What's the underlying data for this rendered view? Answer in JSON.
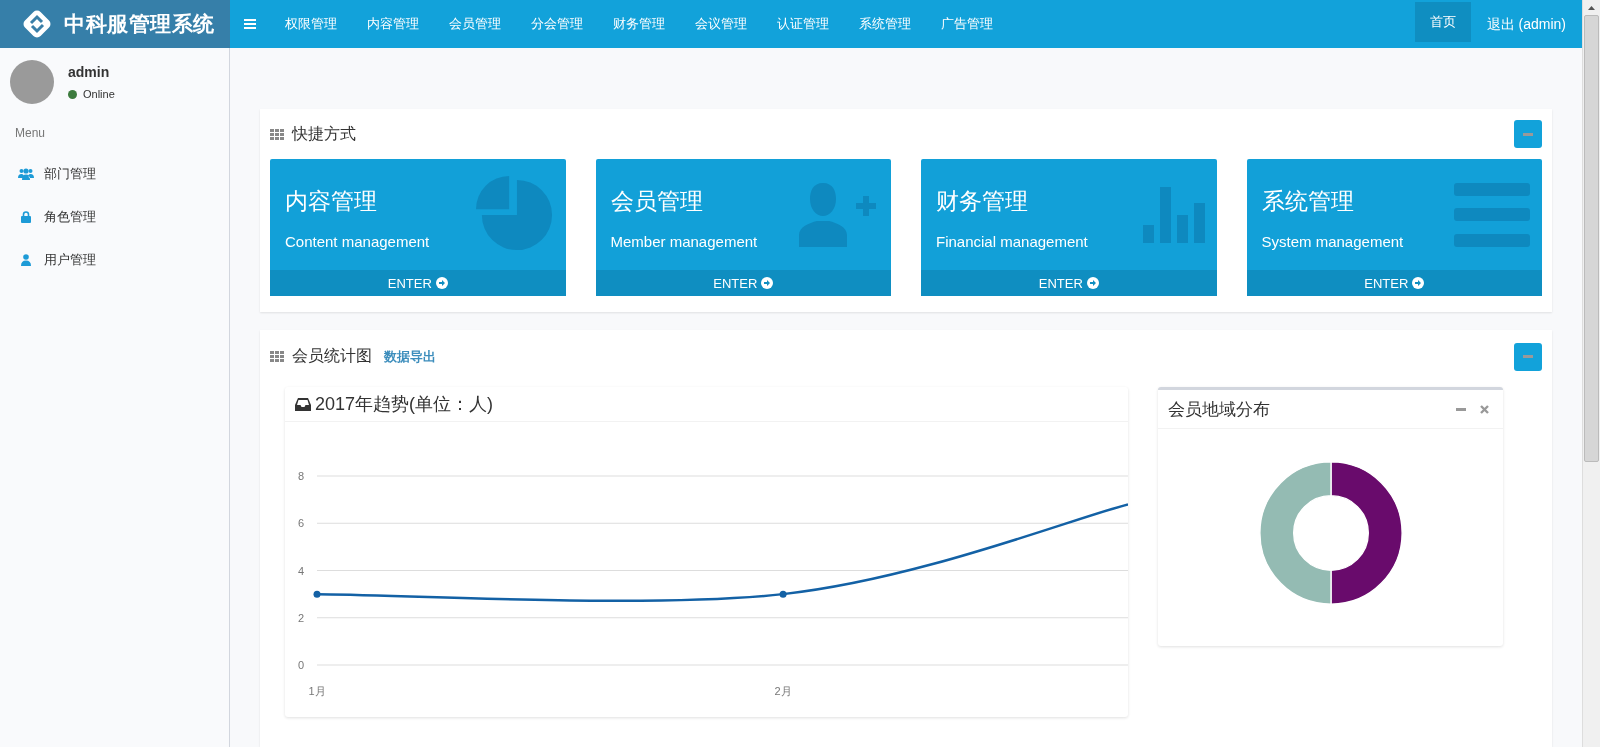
{
  "brand": {
    "title": "中科服管理系统"
  },
  "nav": {
    "items": [
      "权限管理",
      "内容管理",
      "会员管理",
      "分会管理",
      "财务管理",
      "会议管理",
      "认证管理",
      "系统管理",
      "广告管理"
    ],
    "right": [
      {
        "label": "首页",
        "selected": true
      },
      {
        "label": "退出 (admin)",
        "selected": false
      }
    ]
  },
  "user": {
    "name": "admin",
    "status": "Online"
  },
  "sidebar": {
    "heading": "Menu",
    "items": [
      {
        "label": "部门管理",
        "kind": "group"
      },
      {
        "label": "角色管理",
        "kind": "lock"
      },
      {
        "label": "用户管理",
        "kind": "user"
      }
    ]
  },
  "shortcuts": {
    "title": "快捷方式",
    "cards": [
      {
        "title": "内容管理",
        "subtitle": "Content management",
        "footer": "ENTER",
        "kind": "pie"
      },
      {
        "title": "会员管理",
        "subtitle": "Member management",
        "footer": "ENTER",
        "kind": "person"
      },
      {
        "title": "财务管理",
        "subtitle": "Financial management",
        "footer": "ENTER",
        "kind": "bars"
      },
      {
        "title": "系统管理",
        "subtitle": "System management",
        "footer": "ENTER",
        "kind": "list"
      }
    ]
  },
  "stats": {
    "title": "会员统计图",
    "export_link": "数据导出",
    "trend": {
      "title": "2017年趋势(单位：人)",
      "chart_data": {
        "type": "line",
        "x": [
          1,
          2,
          2.74
        ],
        "xlim": [
          1,
          2.74
        ],
        "grid": true,
        "ylim": [
          0,
          8
        ],
        "xticks": [
          {
            "value": 1,
            "label": "1月"
          },
          {
            "value": 2,
            "label": "2月"
          }
        ],
        "yticks": [
          0,
          2,
          4,
          6,
          8
        ],
        "series": [
          {
            "color": "#1361a5",
            "values": [
              3,
              3,
              6.8
            ]
          }
        ]
      }
    },
    "region": {
      "title": "会员地域分布",
      "slices": [
        {
          "color": "#690b6c"
        },
        {
          "color": "#94bbb3"
        }
      ]
    }
  }
}
